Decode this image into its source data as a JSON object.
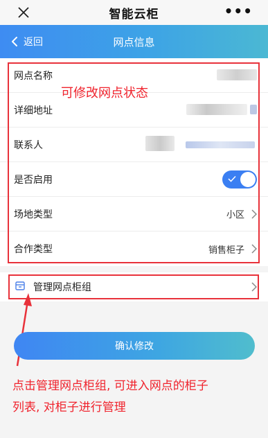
{
  "wx_bar": {
    "title": "智能云柜",
    "more_label": "•••",
    "close_icon": "close-icon",
    "more_icon": "more-dots-icon"
  },
  "nav": {
    "back_label": "返回",
    "title": "网点信息",
    "back_icon": "chevron-left-icon"
  },
  "form": {
    "rows": [
      {
        "label": "网点名称",
        "value": ""
      },
      {
        "label": "详细地址",
        "value": ""
      },
      {
        "label": "联系人",
        "value": ""
      },
      {
        "label": "是否启用",
        "enabled": true
      },
      {
        "label": "场地类型",
        "value": "小区"
      },
      {
        "label": "合作类型",
        "value": "销售柜子"
      }
    ]
  },
  "manage": {
    "label": "管理网点柜组",
    "icon": "cabinet-icon"
  },
  "confirm_label": "确认修改",
  "annotations": {
    "form_note": "可修改网点状态",
    "manage_note_line1": "点击管理网点柜组, 可进入网点的柜子",
    "manage_note_line2": "列表, 对柜子进行管理"
  },
  "colors": {
    "accent": "#3b7ff2",
    "annotation": "#e8313a"
  }
}
